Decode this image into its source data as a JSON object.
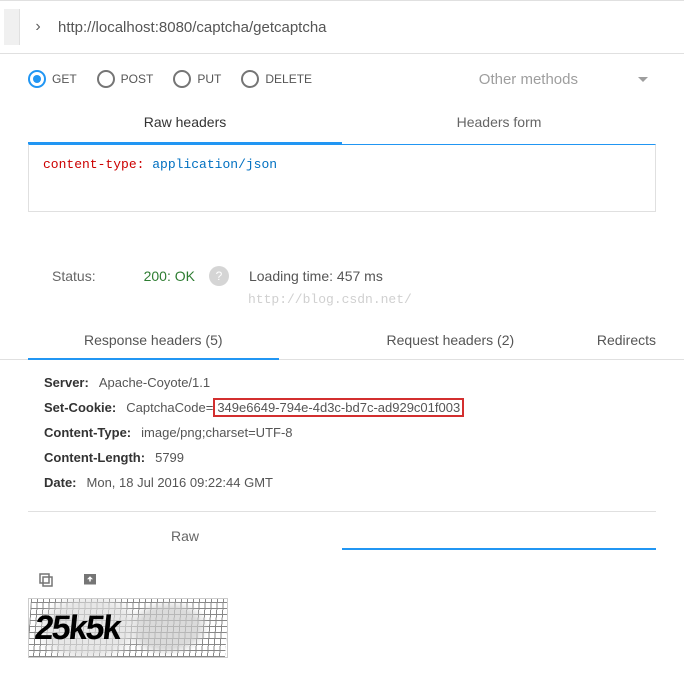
{
  "url": "http://localhost:8080/captcha/getcaptcha",
  "methods": {
    "items": [
      {
        "key": "GET",
        "label": "GET",
        "checked": true
      },
      {
        "key": "POST",
        "label": "POST",
        "checked": false
      },
      {
        "key": "PUT",
        "label": "PUT",
        "checked": false
      },
      {
        "key": "DELETE",
        "label": "DELETE",
        "checked": false
      }
    ],
    "other_label": "Other methods"
  },
  "header_tabs": {
    "raw": "Raw headers",
    "form": "Headers form"
  },
  "request_headers_editor": {
    "key": "content-type",
    "value": "application/json"
  },
  "status": {
    "label": "Status:",
    "code": "200: OK",
    "loading_time": "Loading time: 457 ms"
  },
  "watermark": "http://blog.csdn.net/",
  "response_tabs": {
    "headers_resp": "Response headers (5)",
    "headers_req": "Request headers (2)",
    "redirects": "Redirects"
  },
  "response_headers": [
    {
      "name": "Server:",
      "value": "Apache-Coyote/1.1"
    },
    {
      "name": "Set-Cookie:",
      "prefix": "CaptchaCode=",
      "highlight": "349e6649-794e-4d3c-bd7c-ad929c01f003"
    },
    {
      "name": "Content-Type:",
      "value": "image/png;charset=UTF-8"
    },
    {
      "name": "Content-Length:",
      "value": "5799"
    },
    {
      "name": "Date:",
      "value": "Mon, 18 Jul 2016 09:22:44 GMT"
    }
  ],
  "body_tabs": {
    "raw": "Raw"
  },
  "captcha_text": "25k5k"
}
